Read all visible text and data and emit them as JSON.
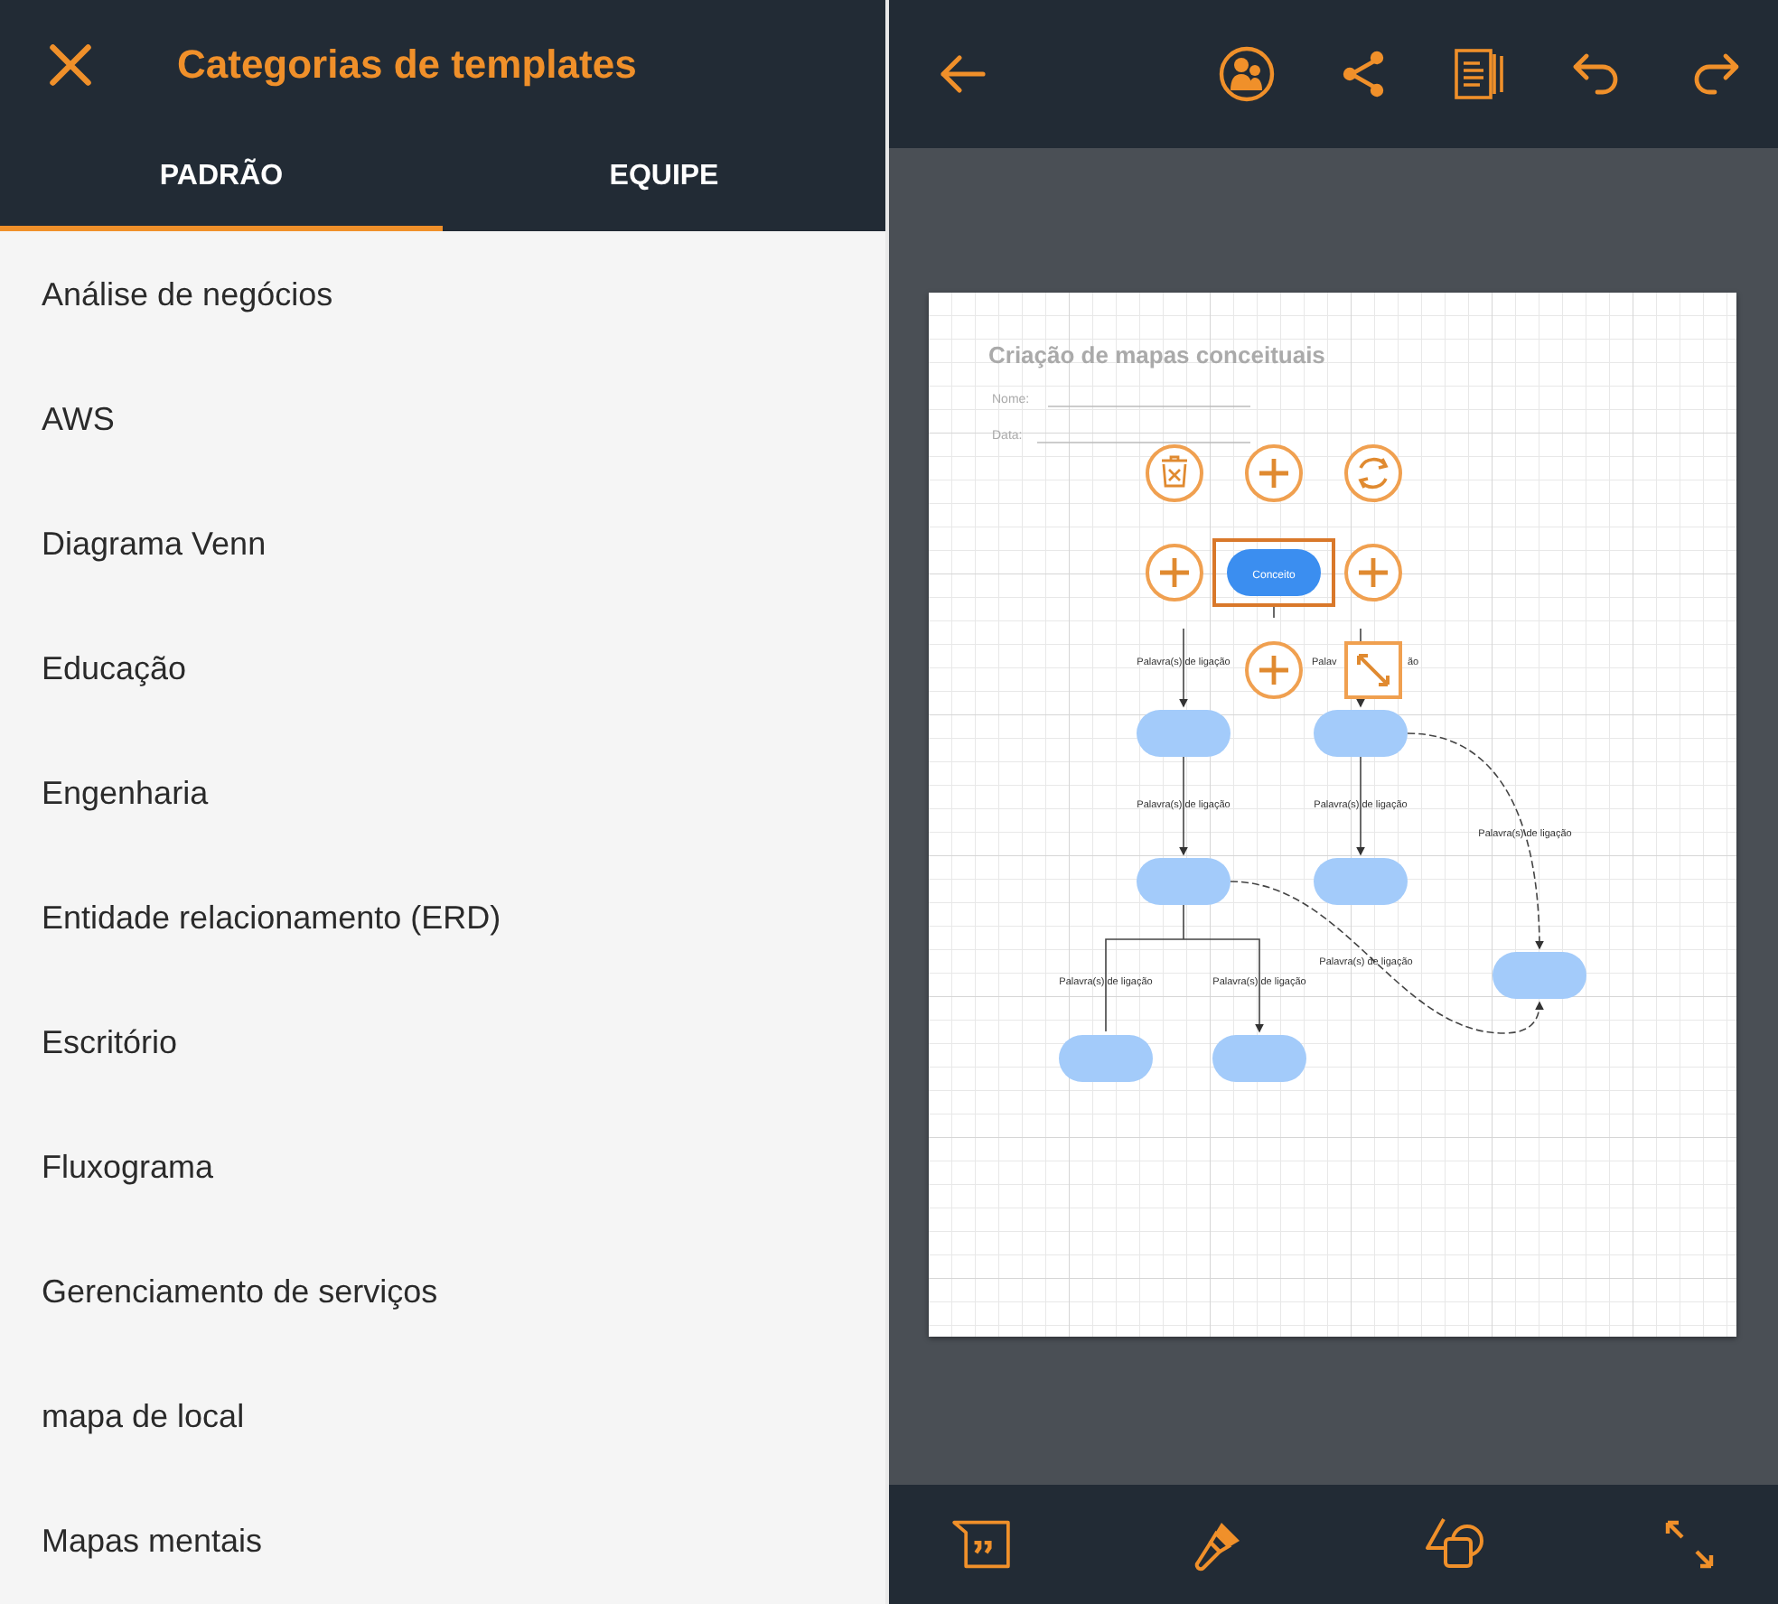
{
  "header": {
    "title": "Categorias de templates"
  },
  "tabs": [
    {
      "label": "PADRÃO",
      "selected": true
    },
    {
      "label": "EQUIPE",
      "selected": false
    }
  ],
  "categories": [
    "Análise de negócios",
    "AWS",
    "Diagrama Venn",
    "Educação",
    "Engenharia",
    "Entidade relacionamento (ERD)",
    "Escritório",
    "Fluxograma",
    "Gerenciamento de serviços",
    "mapa de local",
    "Mapas mentais"
  ],
  "document": {
    "title": "Criação de mapas conceituais",
    "fields": [
      "Nome:",
      "Data:"
    ]
  },
  "nodes": [
    {
      "text": "Conceito",
      "selected": true
    },
    {
      "selected": false
    },
    {
      "selected": false
    },
    {
      "selected": false
    },
    {
      "selected": false
    },
    {
      "selected": false
    },
    {
      "selected": false
    },
    {
      "selected": false
    }
  ],
  "link_labels": [
    "Palavra(s) de ligação",
    "Palav",
    "ão",
    "Palavra(s) de ligação",
    "Palavra(s) de ligação",
    "Palavra(s) de ligação",
    "Palavra(s) de ligação",
    "Palavra(s) de ligação",
    "Palavra(s) de ligação"
  ]
}
